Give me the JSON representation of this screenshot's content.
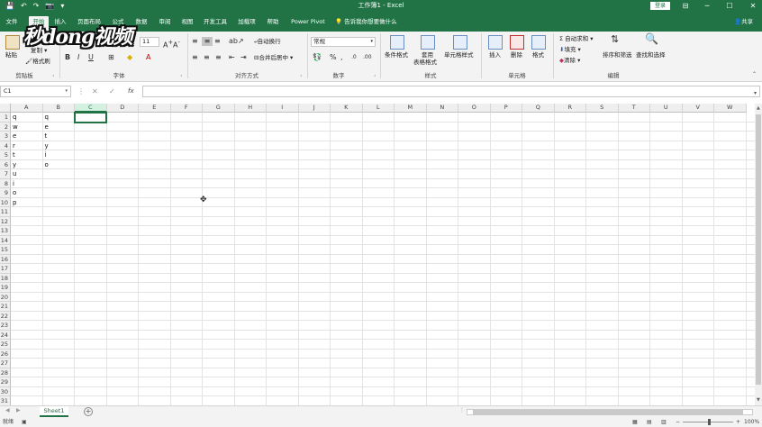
{
  "window": {
    "title": "工作簿1 - Excel",
    "login_label": "登录",
    "qat": [
      "💾",
      "↶",
      "↷",
      "📷",
      "▾"
    ],
    "controls": [
      "⊟",
      "─",
      "☐",
      "✕"
    ]
  },
  "tabs": [
    {
      "label": "文件"
    },
    {
      "label": "开始"
    },
    {
      "label": "插入"
    },
    {
      "label": "页面布局"
    },
    {
      "label": "公式"
    },
    {
      "label": "数据"
    },
    {
      "label": "审阅"
    },
    {
      "label": "视图"
    },
    {
      "label": "开发工具"
    },
    {
      "label": "加载项"
    },
    {
      "label": "帮助"
    },
    {
      "label": "Power Pivot"
    }
  ],
  "tell_me": "告诉我你想要做什么",
  "share_label": "共享",
  "watermark": "秒dong视频",
  "ribbon": {
    "clipboard": {
      "paste": "粘贴",
      "copy": "复制 ▾",
      "format_painter": "格式刷",
      "label": "剪贴板"
    },
    "font": {
      "name": "",
      "size": "11",
      "bold": "B",
      "italic": "I",
      "underline": "U",
      "label": "字体"
    },
    "alignment": {
      "wrap": "自动换行",
      "merge": "合并后居中 ▾",
      "label": "对齐方式"
    },
    "number": {
      "format": "常规",
      "label": "数字"
    },
    "styles": {
      "conditional": "条件格式",
      "table_1": "套用",
      "table_2": "表格格式",
      "cell_styles": "单元格样式",
      "label": "样式"
    },
    "cells": {
      "insert": "插入",
      "delete": "删除",
      "format": "格式",
      "label": "单元格"
    },
    "editing": {
      "autosum": "Σ 自动求和 ▾",
      "fill": "填充 ▾",
      "clear": "清除 ▾",
      "sort": "排序和筛选",
      "find": "查找和选择",
      "label": "编辑"
    }
  },
  "formula_bar": {
    "name_box": "C1",
    "fx": "fx",
    "value": ""
  },
  "grid": {
    "columns": [
      "A",
      "B",
      "C",
      "D",
      "E",
      "F",
      "G",
      "H",
      "I",
      "J",
      "K",
      "L",
      "M",
      "N",
      "O",
      "P",
      "Q",
      "R",
      "S",
      "T",
      "U",
      "V",
      "W"
    ],
    "selected_column": "C",
    "row_count": 31,
    "column_a": [
      "q",
      "w",
      "e",
      "r",
      "t",
      "y",
      "u",
      "i",
      "o",
      "p"
    ],
    "column_b": [
      "q",
      "e",
      "t",
      "y",
      "i",
      "o"
    ]
  },
  "sheet_tabs": [
    {
      "label": "Sheet1"
    }
  ],
  "status": {
    "mode": "就绪",
    "zoom": "100%"
  },
  "colors": {
    "accent": "#217346",
    "ribbon_bg": "#f3f3f3"
  }
}
